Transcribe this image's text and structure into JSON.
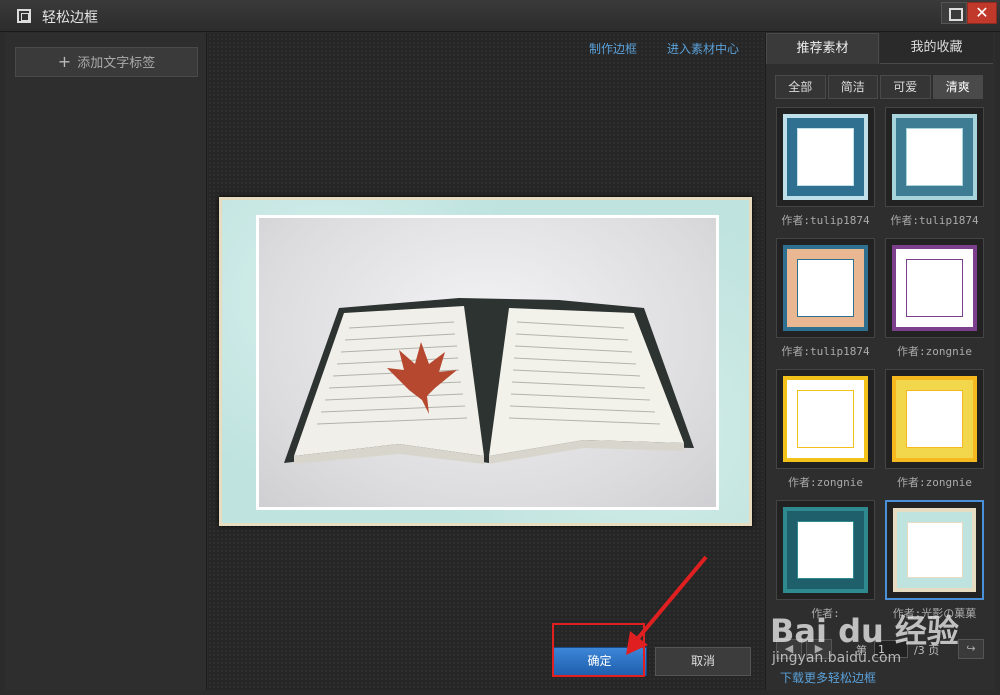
{
  "window": {
    "title": "轻松边框",
    "maximize_icon": "maximize-icon",
    "close_icon": "close-icon",
    "close_glyph": "✕"
  },
  "left_panel": {
    "add_text_label": "添加文字标签",
    "plus_glyph": "+"
  },
  "canvas": {
    "link_make_frame": "制作边框",
    "link_enter_material": "进入素材中心",
    "confirm_label": "确定",
    "cancel_label": "取消"
  },
  "right_panel": {
    "tabs": [
      {
        "label": "推荐素材",
        "active": true
      },
      {
        "label": "我的收藏",
        "active": false
      }
    ],
    "filters": [
      {
        "label": "全部",
        "active": false
      },
      {
        "label": "简洁",
        "active": false
      },
      {
        "label": "可爱",
        "active": false
      },
      {
        "label": "清爽",
        "active": true
      }
    ],
    "thumbnails": [
      {
        "caption": "作者:tulip1874",
        "frame_color": "#2f6f8f",
        "inner": "#ffffff",
        "accent": "#bfe0e8"
      },
      {
        "caption": "作者:tulip1874",
        "frame_color": "#3d7c92",
        "inner": "#ffffff",
        "accent": "#a8d4dc"
      },
      {
        "caption": "作者:tulip1874",
        "frame_color": "#e9b893",
        "inner": "#ffffff",
        "accent": "#2f6f8f"
      },
      {
        "caption": "作者:zongnie",
        "frame_color": "#ffffff",
        "inner": "#ffffff",
        "accent": "#7b3f8c"
      },
      {
        "caption": "作者:zongnie",
        "frame_color": "#ffffff",
        "inner": "#ffffff",
        "accent": "#f2c21b"
      },
      {
        "caption": "作者:zongnie",
        "frame_color": "#f2d64b",
        "inner": "#ffffff",
        "accent": "#f5b91f"
      },
      {
        "caption": "作者:",
        "frame_color": "#1f5e6b",
        "inner": "#ffffff",
        "accent": "#2f8a8f"
      },
      {
        "caption": "作者:光影の菓菓",
        "frame_color": "#bfe3df",
        "inner": "#ffffff",
        "accent": "#e6dcc1",
        "selected": true
      }
    ],
    "pager": {
      "prev_glyph": "◀",
      "next_glyph": "▶",
      "page_prefix": "第",
      "page_value": "1",
      "page_suffix": "/3 页",
      "jump_glyph": "↪"
    },
    "download_more": "下载更多轻松边框"
  },
  "watermark": {
    "brand": "Bai du 经验",
    "url": "jingyan.baidu.com"
  },
  "colors": {
    "accent_blue": "#3d86d8",
    "link_blue": "#5aa0d8",
    "highlight_red": "#e02020",
    "close_red": "#c0392b"
  }
}
